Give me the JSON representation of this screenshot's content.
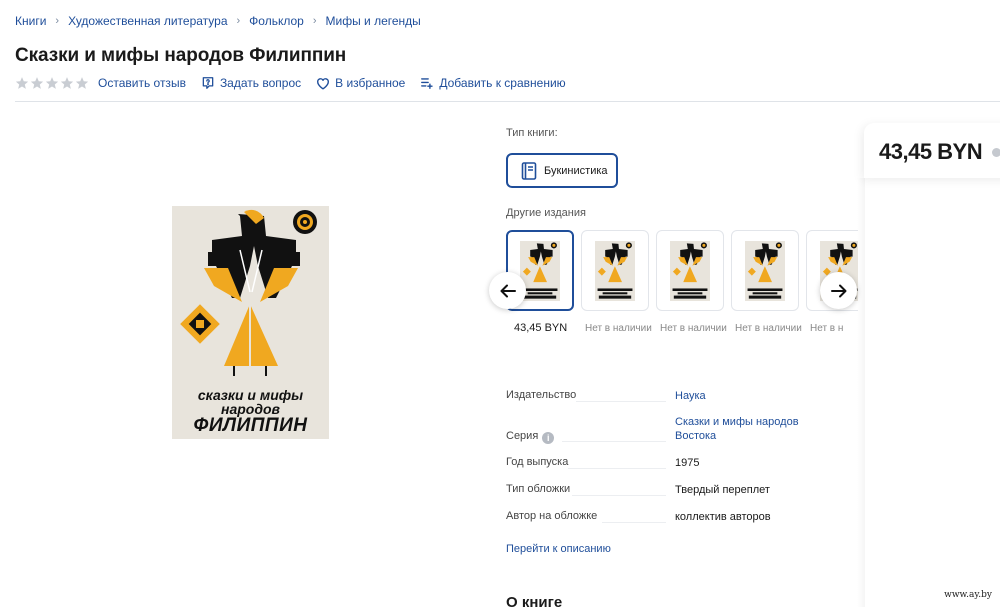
{
  "breadcrumb": [
    "Книги",
    "Художественная литература",
    "Фольклор",
    "Мифы и легенды"
  ],
  "title": "Сказки и мифы народов Филиппин",
  "rating": {
    "value": 0,
    "max": 5
  },
  "actions": {
    "review": "Оставить отзыв",
    "question": "Задать вопрос",
    "favorite": "В избранное",
    "compare": "Добавить к сравнению"
  },
  "cover": {
    "line1": "сказки и мифы",
    "line2": "народов",
    "line3": "ФИЛИППИН"
  },
  "book_type": {
    "label": "Тип книги:",
    "selected": "Букинистика"
  },
  "other_editions": {
    "label": "Другие издания",
    "items": [
      {
        "price": "43,45 BYN",
        "selected": true
      },
      {
        "price": "Нет в наличии",
        "selected": false
      },
      {
        "price": "Нет в наличии",
        "selected": false
      },
      {
        "price": "Нет в наличии",
        "selected": false
      },
      {
        "price": "Нет в н",
        "selected": false
      }
    ]
  },
  "specs": [
    {
      "key": "Издательство",
      "value": "Наука",
      "link": true
    },
    {
      "key": "Серия",
      "value": "Сказки и мифы народов Востока",
      "link": true,
      "info": true
    },
    {
      "key": "Год выпуска",
      "value": "1975",
      "link": false
    },
    {
      "key": "Тип обложки",
      "value": "Твердый переплет",
      "link": false
    },
    {
      "key": "Автор на обложке",
      "value": "коллектив авторов",
      "link": false
    }
  ],
  "goto_description": "Перейти к описанию",
  "about_title": "О книге",
  "price": "43,45 BYN",
  "watermark": "www.ay.by",
  "colors": {
    "link": "#1f4e9a",
    "accent_orange": "#f0a820",
    "cover_bg": "#e8e4dc"
  }
}
